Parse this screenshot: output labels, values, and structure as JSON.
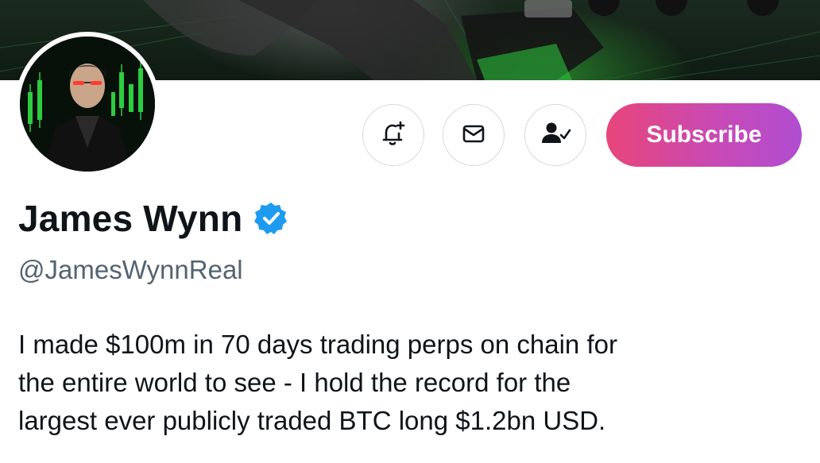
{
  "profile": {
    "display_name": "James Wynn",
    "handle": "@JamesWynnReal",
    "verified": true,
    "bio_lines": [
      "I made $100m in 70 days trading perps on chain for",
      "the entire world to see - I hold the record for the",
      "largest ever publicly traded BTC long $1.2bn USD."
    ]
  },
  "actions": {
    "notifications_icon": "bell-plus-icon",
    "message_icon": "envelope-icon",
    "follow_icon": "person-check-icon",
    "subscribe_label": "Subscribe"
  },
  "colors": {
    "subscribe_gradient_start": "#e8457a",
    "subscribe_gradient_end": "#b04dd0",
    "verified_blue": "#1d9bf0",
    "handle_gray": "#536471",
    "banner_green": "#2ecc40"
  }
}
